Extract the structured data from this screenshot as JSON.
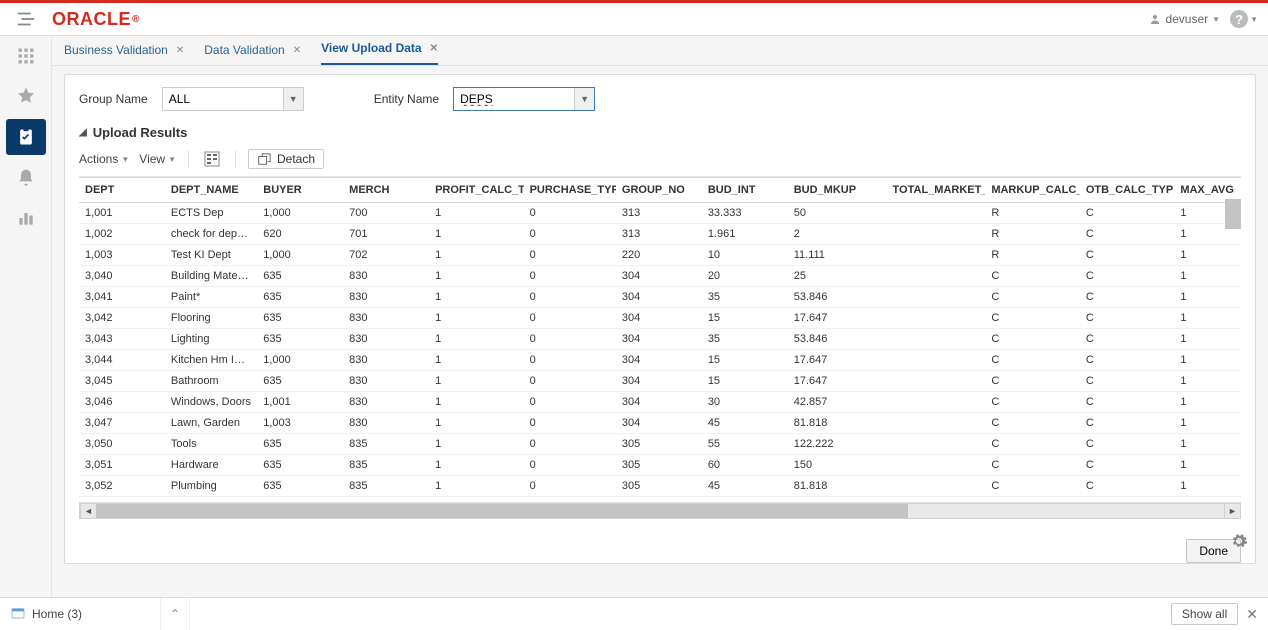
{
  "header": {
    "logo_text": "ORACLE",
    "user": "devuser",
    "help_icon": "?"
  },
  "tabs": [
    {
      "label": "Business Validation",
      "active": false
    },
    {
      "label": "Data Validation",
      "active": false
    },
    {
      "label": "View Upload Data",
      "active": true
    }
  ],
  "filters": {
    "group_label": "Group Name",
    "group_value": "ALL",
    "entity_label": "Entity Name",
    "entity_value": "DEPS"
  },
  "section_title": "Upload Results",
  "toolbar": {
    "actions": "Actions",
    "view": "View",
    "detach": "Detach"
  },
  "columns": [
    "DEPT",
    "DEPT_NAME",
    "BUYER",
    "MERCH",
    "PROFIT_CALC_TY",
    "PURCHASE_TYPE",
    "GROUP_NO",
    "BUD_INT",
    "BUD_MKUP",
    "TOTAL_MARKET_/",
    "MARKUP_CALC_T",
    "OTB_CALC_TYPE",
    "MAX_AVG"
  ],
  "rows": [
    {
      "dept": "1,001",
      "name": "ECTS Dep",
      "buyer": "1,000",
      "merch": "700",
      "profit": "1",
      "purch": "0",
      "group": "313",
      "budint": "33.333",
      "budmk": "50",
      "tmkt": "",
      "mcalc": "R",
      "otb": "C",
      "maxavg": "1"
    },
    {
      "dept": "1,002",
      "name": "check for deps v…",
      "buyer": "620",
      "merch": "701",
      "profit": "1",
      "purch": "0",
      "group": "313",
      "budint": "1.961",
      "budmk": "2",
      "tmkt": "",
      "mcalc": "R",
      "otb": "C",
      "maxavg": "1"
    },
    {
      "dept": "1,003",
      "name": "Test KI Dept",
      "buyer": "1,000",
      "merch": "702",
      "profit": "1",
      "purch": "0",
      "group": "220",
      "budint": "10",
      "budmk": "11.111",
      "tmkt": "",
      "mcalc": "R",
      "otb": "C",
      "maxavg": "1"
    },
    {
      "dept": "3,040",
      "name": "Building Materials",
      "buyer": "635",
      "merch": "830",
      "profit": "1",
      "purch": "0",
      "group": "304",
      "budint": "20",
      "budmk": "25",
      "tmkt": "",
      "mcalc": "C",
      "otb": "C",
      "maxavg": "1"
    },
    {
      "dept": "3,041",
      "name": "Paint*",
      "buyer": "635",
      "merch": "830",
      "profit": "1",
      "purch": "0",
      "group": "304",
      "budint": "35",
      "budmk": "53.846",
      "tmkt": "",
      "mcalc": "C",
      "otb": "C",
      "maxavg": "1"
    },
    {
      "dept": "3,042",
      "name": "Flooring",
      "buyer": "635",
      "merch": "830",
      "profit": "1",
      "purch": "0",
      "group": "304",
      "budint": "15",
      "budmk": "17.647",
      "tmkt": "",
      "mcalc": "C",
      "otb": "C",
      "maxavg": "1"
    },
    {
      "dept": "3,043",
      "name": "Lighting",
      "buyer": "635",
      "merch": "830",
      "profit": "1",
      "purch": "0",
      "group": "304",
      "budint": "35",
      "budmk": "53.846",
      "tmkt": "",
      "mcalc": "C",
      "otb": "C",
      "maxavg": "1"
    },
    {
      "dept": "3,044",
      "name": "Kitchen Hm Imp …",
      "buyer": "1,000",
      "merch": "830",
      "profit": "1",
      "purch": "0",
      "group": "304",
      "budint": "15",
      "budmk": "17.647",
      "tmkt": "",
      "mcalc": "C",
      "otb": "C",
      "maxavg": "1"
    },
    {
      "dept": "3,045",
      "name": "Bathroom",
      "buyer": "635",
      "merch": "830",
      "profit": "1",
      "purch": "0",
      "group": "304",
      "budint": "15",
      "budmk": "17.647",
      "tmkt": "",
      "mcalc": "C",
      "otb": "C",
      "maxavg": "1"
    },
    {
      "dept": "3,046",
      "name": "Windows, Doors",
      "buyer": "1,001",
      "merch": "830",
      "profit": "1",
      "purch": "0",
      "group": "304",
      "budint": "30",
      "budmk": "42.857",
      "tmkt": "",
      "mcalc": "C",
      "otb": "C",
      "maxavg": "1"
    },
    {
      "dept": "3,047",
      "name": "Lawn, Garden",
      "buyer": "1,003",
      "merch": "830",
      "profit": "1",
      "purch": "0",
      "group": "304",
      "budint": "45",
      "budmk": "81.818",
      "tmkt": "",
      "mcalc": "C",
      "otb": "C",
      "maxavg": "1"
    },
    {
      "dept": "3,050",
      "name": "Tools",
      "buyer": "635",
      "merch": "835",
      "profit": "1",
      "purch": "0",
      "group": "305",
      "budint": "55",
      "budmk": "122.222",
      "tmkt": "",
      "mcalc": "C",
      "otb": "C",
      "maxavg": "1"
    },
    {
      "dept": "3,051",
      "name": "Hardware",
      "buyer": "635",
      "merch": "835",
      "profit": "1",
      "purch": "0",
      "group": "305",
      "budint": "60",
      "budmk": "150",
      "tmkt": "",
      "mcalc": "C",
      "otb": "C",
      "maxavg": "1"
    },
    {
      "dept": "3,052",
      "name": "Plumbing",
      "buyer": "635",
      "merch": "835",
      "profit": "1",
      "purch": "0",
      "group": "305",
      "budint": "45",
      "budmk": "81.818",
      "tmkt": "",
      "mcalc": "C",
      "otb": "C",
      "maxavg": "1"
    }
  ],
  "buttons": {
    "done": "Done",
    "show_all": "Show all"
  },
  "taskbar": {
    "home": "Home (3)"
  }
}
